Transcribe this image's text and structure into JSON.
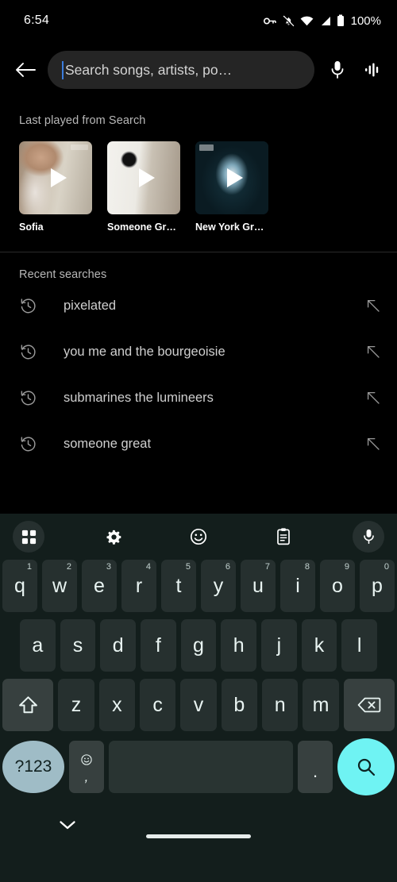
{
  "status_bar": {
    "time": "6:54",
    "battery_percent": "100%",
    "icons": [
      "vpn-key-icon",
      "notifications-muted-icon",
      "wifi-icon",
      "cellular-signal-icon",
      "battery-icon"
    ]
  },
  "search": {
    "back_icon": "back-arrow-icon",
    "placeholder": "Search songs, artists, po…",
    "value": "",
    "mic_icon": "microphone-icon",
    "sound_search_icon": "sound-wave-icon"
  },
  "last_played": {
    "title": "Last played from Search",
    "items": [
      {
        "label": "Sofia",
        "art": "art-sofia"
      },
      {
        "label": "Someone Great",
        "art": "art-great"
      },
      {
        "label": "New York Groove",
        "art": "art-nyg"
      }
    ]
  },
  "recent_searches": {
    "title": "Recent searches",
    "items": [
      {
        "query": "pixelated"
      },
      {
        "query": "you me and the bourgeoisie"
      },
      {
        "query": "submarines the lumineers"
      },
      {
        "query": "someone great"
      }
    ]
  },
  "keyboard": {
    "toolbar": [
      {
        "name": "toolbar-grid-icon",
        "circled": true
      },
      {
        "name": "toolbar-settings-icon",
        "circled": false
      },
      {
        "name": "toolbar-emoji-icon",
        "circled": false
      },
      {
        "name": "toolbar-clipboard-icon",
        "circled": false
      },
      {
        "name": "toolbar-mic-icon",
        "circled": true
      }
    ],
    "row1": [
      {
        "key": "q",
        "num": "1"
      },
      {
        "key": "w",
        "num": "2"
      },
      {
        "key": "e",
        "num": "3"
      },
      {
        "key": "r",
        "num": "4"
      },
      {
        "key": "t",
        "num": "5"
      },
      {
        "key": "y",
        "num": "6"
      },
      {
        "key": "u",
        "num": "7"
      },
      {
        "key": "i",
        "num": "8"
      },
      {
        "key": "o",
        "num": "9"
      },
      {
        "key": "p",
        "num": "0"
      }
    ],
    "row2": [
      {
        "key": "a"
      },
      {
        "key": "s"
      },
      {
        "key": "d"
      },
      {
        "key": "f"
      },
      {
        "key": "g"
      },
      {
        "key": "h"
      },
      {
        "key": "j"
      },
      {
        "key": "k"
      },
      {
        "key": "l"
      }
    ],
    "row3": [
      {
        "key": "z"
      },
      {
        "key": "x"
      },
      {
        "key": "c"
      },
      {
        "key": "v"
      },
      {
        "key": "b"
      },
      {
        "key": "n"
      },
      {
        "key": "m"
      }
    ],
    "shift_icon": "shift-key-icon",
    "backspace_icon": "backspace-key-icon",
    "symbols_label": "?123",
    "comma_label": ",",
    "period_label": ".",
    "space_label": "",
    "enter_icon": "search-key-icon",
    "accent_color": "#6ff3f3",
    "symbols_key_color": "#9fbcc6",
    "key_color": "#26302f",
    "background_color": "#131e1c"
  },
  "navigation": {
    "hide_keyboard_icon": "chevron-down-icon",
    "home_indicator": "home-indicator-pill"
  }
}
